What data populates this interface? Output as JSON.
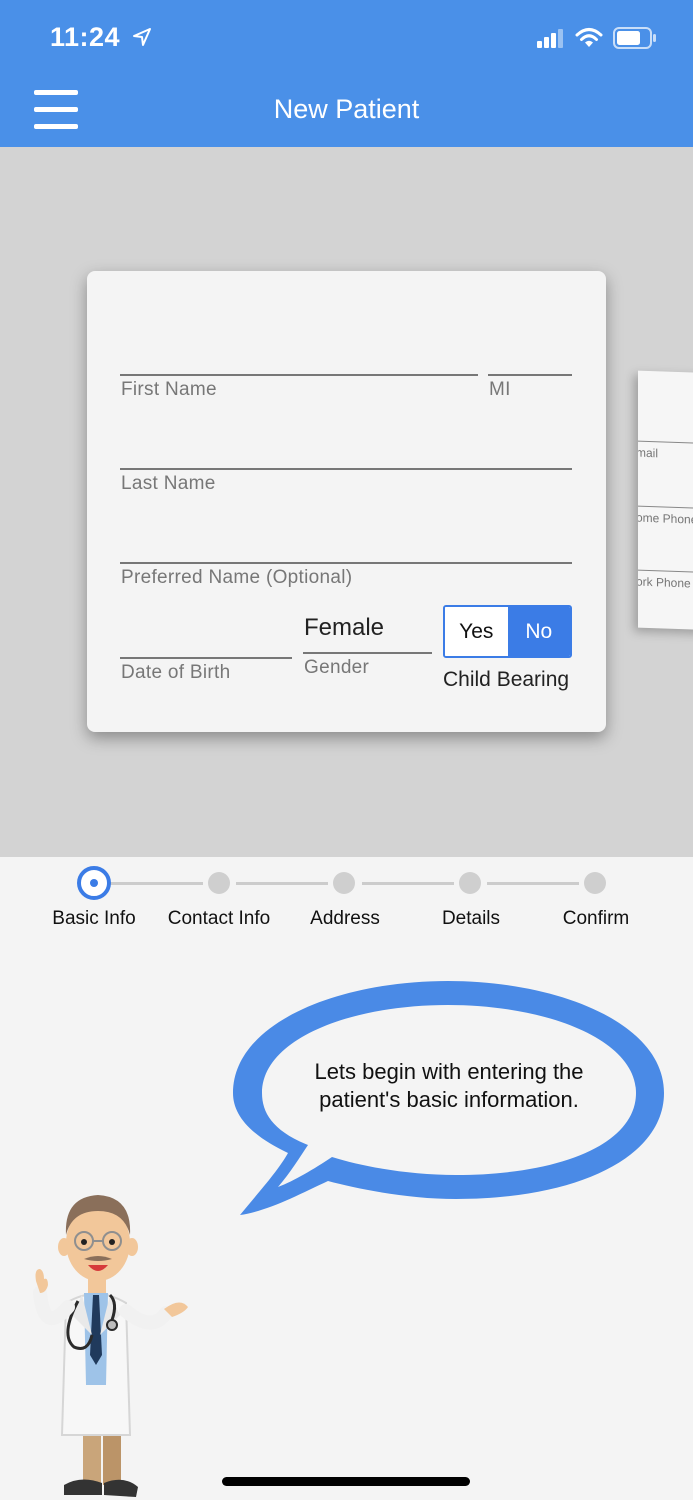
{
  "status_bar": {
    "time": "11:24"
  },
  "header": {
    "title": "New Patient"
  },
  "form": {
    "first_name_label": "First Name",
    "mi_label": "MI",
    "last_name_label": "Last Name",
    "preferred_name_label": "Preferred Name (Optional)",
    "dob_label": "Date of Birth",
    "gender_label": "Gender",
    "gender_value": "Female",
    "child_bearing_label": "Child Bearing",
    "child_bearing_yes": "Yes",
    "child_bearing_no": "No",
    "child_bearing_selected": "No"
  },
  "next_card": {
    "labels": [
      "mail",
      "ome Phone",
      "ork Phone"
    ]
  },
  "stepper": {
    "steps": [
      {
        "label": "Basic Info",
        "active": true
      },
      {
        "label": "Contact Info",
        "active": false
      },
      {
        "label": "Address",
        "active": false
      },
      {
        "label": "Details",
        "active": false
      },
      {
        "label": "Confirm",
        "active": false
      }
    ]
  },
  "assistant": {
    "message": "Lets begin with entering the patient's basic information."
  },
  "colors": {
    "header": "#4a90e8",
    "accent": "#3b7ce6",
    "carousel_bg": "#d3d3d3"
  }
}
